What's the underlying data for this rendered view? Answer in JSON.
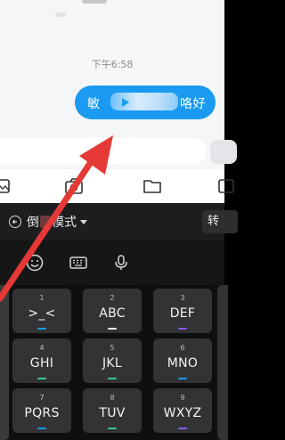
{
  "chat": {
    "timestamp": "下午6:58",
    "bubble_left": "敏",
    "bubble_right": "咯好"
  },
  "ime": {
    "mode_label": "倒",
    "mode_label2": "模式",
    "convert_label": "转"
  },
  "keys": [
    {
      "num": "1",
      "main": ">_<",
      "mark": "#1a9af0"
    },
    {
      "num": "2",
      "main": "ABC",
      "mark": "#ffffff"
    },
    {
      "num": "3",
      "main": "DEF",
      "mark": "#8a5cf0"
    },
    {
      "num": "4",
      "main": "GHI",
      "mark": "#3cc3a0"
    },
    {
      "num": "5",
      "main": "JKL",
      "mark": "#3cc3a0"
    },
    {
      "num": "6",
      "main": "MNO",
      "mark": "#1a9af0"
    },
    {
      "num": "7",
      "main": "PQRS",
      "mark": "#1a9af0"
    },
    {
      "num": "8",
      "main": "TUV",
      "mark": "#3cc3a0"
    },
    {
      "num": "9",
      "main": "WXYZ",
      "mark": "#8a5cf0"
    }
  ],
  "colors": {
    "bubble": "#1a9af0",
    "arrow": "#e53935"
  }
}
